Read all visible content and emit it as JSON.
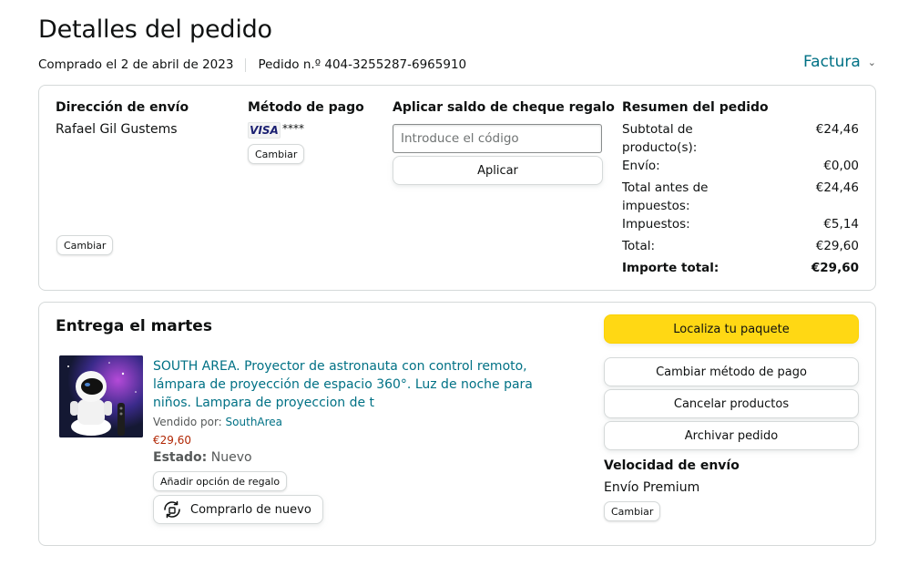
{
  "header": {
    "title": "Detalles del pedido",
    "purchased": "Comprado el 2 de abril de 2023",
    "order_number": "Pedido n.º 404-3255287-6965910",
    "invoice_label": "Factura"
  },
  "summary_box": {
    "shipping": {
      "title": "Dirección de envío",
      "name": "Rafael Gil Gustems",
      "change": "Cambiar"
    },
    "payment": {
      "title": "Método de pago",
      "card_brand": "VISA",
      "card_digits": "****",
      "change": "Cambiar"
    },
    "gift_card": {
      "title": "Aplicar saldo de cheque regalo",
      "placeholder": "Introduce el código",
      "apply": "Aplicar"
    },
    "order_summary": {
      "title": "Resumen del pedido",
      "rows": [
        {
          "label": "Subtotal de producto(s):",
          "value": "€24,46"
        },
        {
          "label": "Envío:",
          "value": "€0,00"
        },
        {
          "label": "Total antes de impuestos:",
          "value": "€24,46"
        },
        {
          "label": "Impuestos:",
          "value": "€5,14"
        },
        {
          "label": "Total:",
          "value": "€29,60"
        },
        {
          "label": "Importe total:",
          "value": "€29,60"
        }
      ]
    }
  },
  "delivery": {
    "title": "Entrega el martes",
    "product_title": "SOUTH AREA. Proyector de astronauta con control remoto, lámpara de proyección de espacio 360°. Luz de noche para niños. Lampara de proyeccion de t",
    "sold_by_label": "Vendido por:",
    "seller": "SouthArea",
    "price": "€29,60",
    "status_label": "Estado:",
    "status_value": "Nuevo",
    "gift_option": "Añadir opción de regalo",
    "buy_again": "Comprarlo de nuevo",
    "actions": {
      "track": "Localiza tu paquete",
      "change_payment": "Cambiar método de pago",
      "cancel": "Cancelar productos",
      "archive": "Archivar pedido"
    },
    "shipping_speed_title": "Velocidad de envío",
    "shipping_speed_value": "Envío Premium",
    "shipping_change": "Cambiar"
  },
  "colors": {
    "link": "#007185",
    "price": "#b12704",
    "primary_button": "#ffd814",
    "border": "#d5d9d9"
  },
  "icons": {
    "invoice_chevron": "chevron-down-icon",
    "buy_again": "buy-again-icon",
    "product_image": "product-thumbnail"
  }
}
